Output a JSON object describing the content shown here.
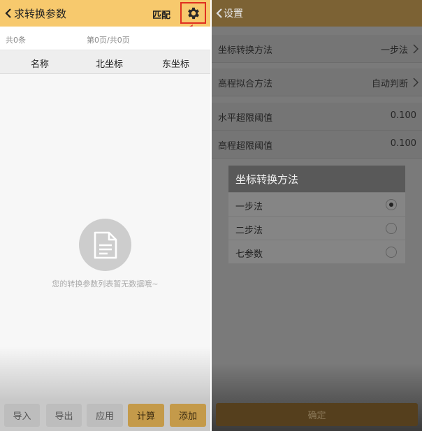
{
  "left_screen": {
    "header": {
      "title": "求转换参数",
      "match_label": "匹配",
      "back_icon": "chevron-left-icon",
      "settings_icon": "gear-icon"
    },
    "info": {
      "total": "共0条",
      "pagination": "第0页/共0页"
    },
    "columns": [
      "名称",
      "北坐标",
      "东坐标"
    ],
    "empty": {
      "icon": "document-icon",
      "message": "您的转换参数列表暂无数据哦~"
    },
    "footer": {
      "buttons": [
        {
          "label": "导入",
          "style": "grey"
        },
        {
          "label": "导出",
          "style": "grey"
        },
        {
          "label": "应用",
          "style": "grey"
        },
        {
          "label": "计算",
          "style": "gold"
        },
        {
          "label": "添加",
          "style": "gold"
        }
      ]
    }
  },
  "right_screen": {
    "header": {
      "title": "设置",
      "back_icon": "chevron-left-icon"
    },
    "settings": [
      {
        "label": "坐标转换方法",
        "value": "一步法"
      },
      {
        "label": "高程拟合方法",
        "value": "自动判断"
      },
      {
        "label": "水平超限阈值",
        "value": "0.100"
      },
      {
        "label": "高程超限阈值",
        "value": "0.100"
      }
    ],
    "dialog": {
      "title": "坐标转换方法",
      "options": [
        {
          "label": "一步法",
          "selected": true
        },
        {
          "label": "二步法",
          "selected": false
        },
        {
          "label": "七参数",
          "selected": false
        }
      ]
    },
    "confirm_label": "确定"
  },
  "colors": {
    "left_header": "#f7c96d",
    "highlight_box": "#e03020",
    "gold_button": "#c49a4a"
  }
}
